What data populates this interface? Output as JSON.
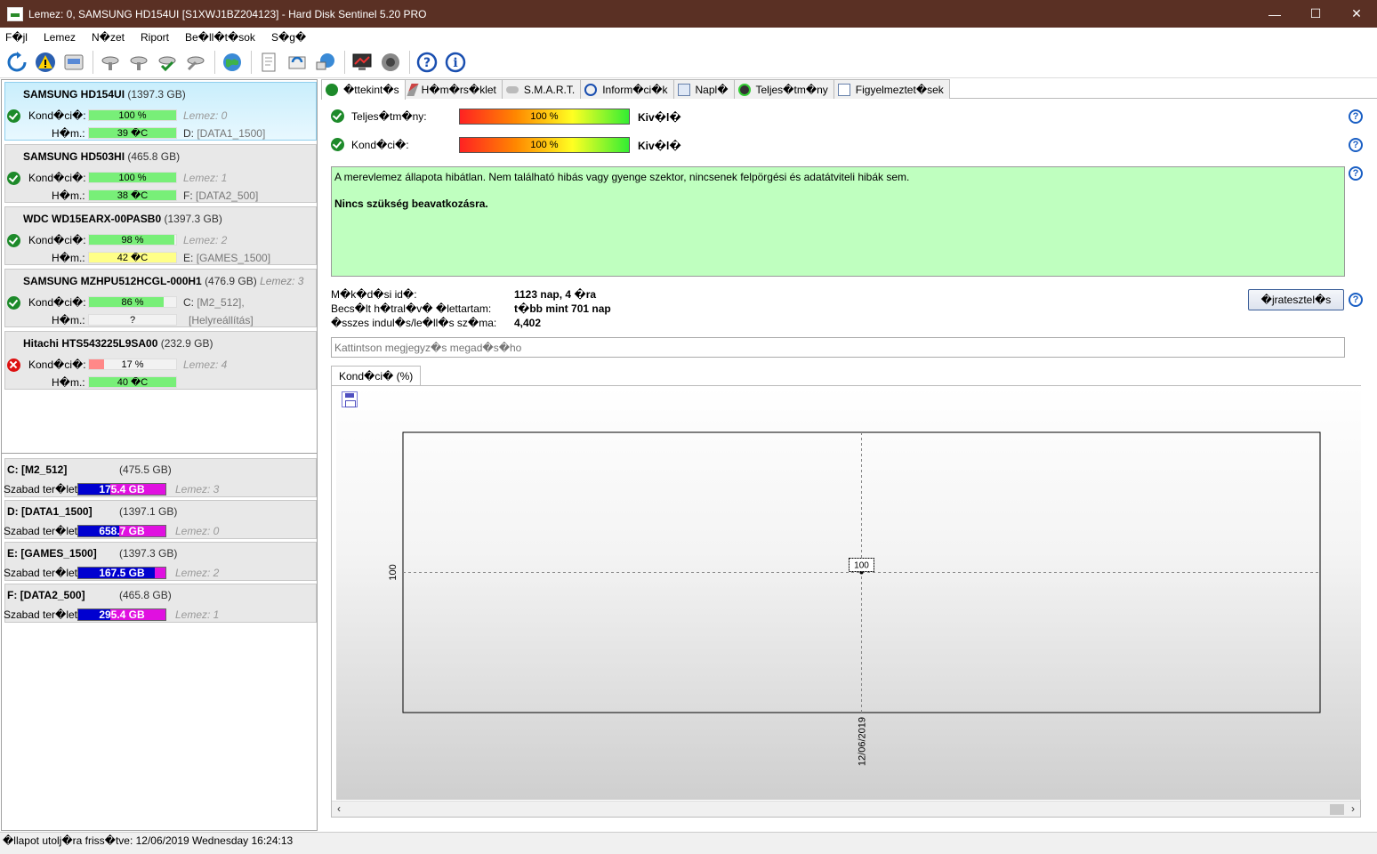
{
  "window": {
    "title": "Lemez: 0, SAMSUNG HD154UI [S1XWJ1BZ204123]  -  Hard Disk Sentinel 5.20 PRO",
    "minimize": "—",
    "maximize": "☐",
    "close": "✕"
  },
  "menu": {
    "items": [
      "F�jl",
      "Lemez",
      "N�zet",
      "Riport",
      "Be�ll�t�sok",
      "S�g�"
    ]
  },
  "toolbar": {
    "icons": [
      "refresh-icon",
      "warning-icon",
      "disk-icon",
      "disk-tool-icon",
      "disk-tool-icon",
      "disk-check-icon",
      "disk-scan-icon",
      "globe-icon",
      "report-icon",
      "update-icon",
      "network-icon",
      "monitor-icon",
      "sound-icon",
      "help-icon",
      "info-icon"
    ]
  },
  "disks": [
    {
      "name": "SAMSUNG HD154UI",
      "size": "(1397.3 GB)",
      "cond_label": "Kond�ci�:",
      "cond": "100 %",
      "cond_pct": 100,
      "temp_label": "H�m.:",
      "temp": "39 �C",
      "temp_color": "#78ef78",
      "lemez": "Lemez: 0",
      "drive": "D:",
      "vol": "[DATA1_1500]",
      "status": "ok",
      "selected": true
    },
    {
      "name": "SAMSUNG HD503HI",
      "size": "(465.8 GB)",
      "cond_label": "Kond�ci�:",
      "cond": "100 %",
      "cond_pct": 100,
      "temp_label": "H�m.:",
      "temp": "38 �C",
      "temp_color": "#78ef78",
      "lemez": "Lemez: 1",
      "drive": "F:",
      "vol": "[DATA2_500]",
      "status": "ok",
      "selected": false
    },
    {
      "name": "WDC WD15EARX-00PASB0",
      "size": "(1397.3 GB)",
      "cond_label": "Kond�ci�:",
      "cond": "98 %",
      "cond_pct": 98,
      "temp_label": "H�m.:",
      "temp": "42 �C",
      "temp_color": "#ffff88",
      "lemez": "Lemez: 2",
      "drive": "E:",
      "vol": "[GAMES_1500]",
      "status": "ok",
      "selected": false
    },
    {
      "name": "SAMSUNG MZHPU512HCGL-000H1",
      "size": "(476.9 GB)",
      "size_lemez": "Lemez: 3",
      "cond_label": "Kond�ci�:",
      "cond": "86 %",
      "cond_pct": 86,
      "temp_label": "H�m.:",
      "temp": "?",
      "temp_color": "#f2f2f2",
      "lemez": "C:",
      "drive": "",
      "vol": "[M2_512],",
      "vol2": "[Helyreállítás]",
      "status": "ok",
      "selected": false
    },
    {
      "name": "Hitachi HTS543225L9SA00",
      "size": "(232.9 GB)",
      "cond_label": "Kond�ci�:",
      "cond": "17 %",
      "cond_pct": 17,
      "temp_label": "H�m.:",
      "temp": "40 �C",
      "temp_color": "#78ef78",
      "lemez": "Lemez: 4",
      "drive": "",
      "vol": "",
      "status": "bad",
      "selected": false
    }
  ],
  "volumes": [
    {
      "name": "C: [M2_512]",
      "size": "(475.5 GB)",
      "free_label": "Szabad ter�let",
      "free": "175.4 GB",
      "free_pct": 37,
      "lemez": "Lemez: 3"
    },
    {
      "name": "D: [DATA1_1500]",
      "size": "(1397.1 GB)",
      "free_label": "Szabad ter�let",
      "free": "658.7 GB",
      "free_pct": 47,
      "lemez": "Lemez: 0"
    },
    {
      "name": "E: [GAMES_1500]",
      "size": "(1397.3 GB)",
      "free_label": "Szabad ter�let",
      "free": "167.5 GB",
      "free_pct": 88,
      "lemez": "Lemez: 2"
    },
    {
      "name": "F: [DATA2_500]",
      "size": "(465.8 GB)",
      "free_label": "Szabad ter�let",
      "free": "295.4 GB",
      "free_pct": 37,
      "lemez": "Lemez: 1"
    }
  ],
  "tabs": [
    {
      "label": "�ttekint�s",
      "icon": "check-icon",
      "active": true
    },
    {
      "label": "H�m�rs�klet",
      "icon": "thermometer-icon",
      "active": false
    },
    {
      "label": "S.M.A.R.T.",
      "icon": "smart-icon",
      "active": false
    },
    {
      "label": "Inform�ci�k",
      "icon": "info-icon",
      "active": false
    },
    {
      "label": "Napl�",
      "icon": "log-icon",
      "active": false
    },
    {
      "label": "Teljes�tm�ny",
      "icon": "performance-icon",
      "active": false
    },
    {
      "label": "Figyelmeztet�sek",
      "icon": "alerts-icon",
      "active": false
    }
  ],
  "overview": {
    "performance_label": "Teljes�tm�ny:",
    "performance_value": "100 %",
    "performance_rating": "Kiv�l�",
    "condition_label": "Kond�ci�:",
    "condition_value": "100 %",
    "condition_rating": "Kiv�l�",
    "message": "A merevlemez állapota hibátlan. Nem található hibás vagy gyenge szektor, nincsenek felpörgési és adatátviteli hibák sem.",
    "advice": "Nincs szükség beavatkozásra.",
    "uptime_label": "M�k�d�si id�:",
    "uptime_value": "1123 nap, 4 �ra",
    "lifetime_label": "Becs�lt h�tral�v� �lettartam:",
    "lifetime_value": "t�bb mint 701 nap",
    "starts_label": "�sszes indul�s/le�ll�s sz�ma:",
    "starts_value": "4,402",
    "retest_button": "�jratesztel�s",
    "note_placeholder": "Kattintson megjegyz�s megad�s�ho",
    "chart_tab": "Kond�ci�  (%)",
    "help": "?"
  },
  "chart_data": {
    "type": "line",
    "title": "",
    "xlabel": "",
    "ylabel": "",
    "x": [
      "12/06/2019"
    ],
    "series": [
      {
        "values": [
          100
        ]
      }
    ],
    "yticks": [
      "100"
    ],
    "point_label": "100",
    "ylim": [
      0,
      200
    ],
    "grid": true
  },
  "status_bar": {
    "text": "�llapot utolj�ra friss�tve: 12/06/2019 Wednesday 16:24:13"
  },
  "colors": {
    "titlebar": "#5a3024",
    "selected_card": "#c9eefc",
    "info_box": "#bfffbf",
    "volume_used": "#0000d0",
    "volume_free": "#e010e0"
  }
}
